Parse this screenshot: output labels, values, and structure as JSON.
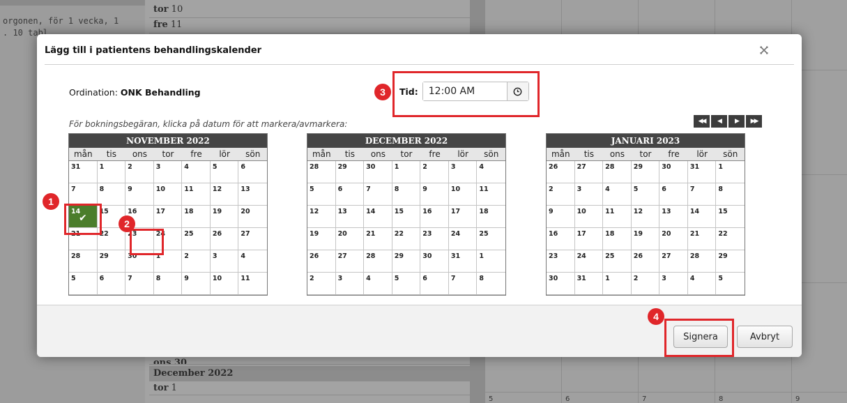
{
  "background": {
    "left_text_lines": [
      "orgonen, för 1 vecka, 1",
      ". 10 tabl"
    ],
    "rows": [
      {
        "day": "tor",
        "num": "10"
      },
      {
        "day": "fre",
        "num": "11"
      }
    ],
    "partial_row": "ons 30",
    "month_header": "December 2022",
    "after_month_row": {
      "day": "tor",
      "num": "1"
    },
    "grid_day_numbers": [
      "5",
      "6",
      "7",
      "8",
      "9"
    ]
  },
  "modal": {
    "title": "Lägg till i patientens behandlingskalender",
    "close_icon": "close-icon",
    "ordination_label": "Ordination:",
    "ordination_value": "ONK Behandling",
    "time_label": "Tid:",
    "time_value": "12:00 AM",
    "time_icon": "clock-icon",
    "instruction": "För bokningsbegäran, klicka på datum för att markera/avmarkera:",
    "nav": {
      "first": "◀◀",
      "prev": "◀",
      "next": "▶",
      "last": "▶▶"
    },
    "weekdays": [
      "mån",
      "tis",
      "ons",
      "tor",
      "fre",
      "lör",
      "sön"
    ],
    "calendars": [
      {
        "title": "NOVEMBER 2022",
        "days": [
          "31",
          "1",
          "2",
          "3",
          "4",
          "5",
          "6",
          "7",
          "8",
          "9",
          "10",
          "11",
          "12",
          "13",
          "14",
          "15",
          "16",
          "17",
          "18",
          "19",
          "20",
          "21",
          "22",
          "23",
          "24",
          "25",
          "26",
          "27",
          "28",
          "29",
          "30",
          "1",
          "2",
          "3",
          "4",
          "5",
          "6",
          "7",
          "8",
          "9",
          "10",
          "11"
        ],
        "selected_index": 14
      },
      {
        "title": "DECEMBER 2022",
        "days": [
          "28",
          "29",
          "30",
          "1",
          "2",
          "3",
          "4",
          "5",
          "6",
          "7",
          "8",
          "9",
          "10",
          "11",
          "12",
          "13",
          "14",
          "15",
          "16",
          "17",
          "18",
          "19",
          "20",
          "21",
          "22",
          "23",
          "24",
          "25",
          "26",
          "27",
          "28",
          "29",
          "30",
          "31",
          "1",
          "2",
          "3",
          "4",
          "5",
          "6",
          "7",
          "8"
        ],
        "selected_index": -1
      },
      {
        "title": "JANUARI 2023",
        "days": [
          "26",
          "27",
          "28",
          "29",
          "30",
          "31",
          "1",
          "2",
          "3",
          "4",
          "5",
          "6",
          "7",
          "8",
          "9",
          "10",
          "11",
          "12",
          "13",
          "14",
          "15",
          "16",
          "17",
          "18",
          "19",
          "20",
          "21",
          "22",
          "23",
          "24",
          "25",
          "26",
          "27",
          "28",
          "29",
          "30",
          "31",
          "1",
          "2",
          "3",
          "4",
          "5"
        ],
        "selected_index": -1
      }
    ],
    "buttons": {
      "sign": "Signera",
      "cancel": "Avbryt"
    }
  },
  "callouts": [
    "1",
    "2",
    "3",
    "4"
  ],
  "colors": {
    "selected_day": "#4b7d2b",
    "callout": "#e0262a",
    "calendar_header": "#454545"
  }
}
